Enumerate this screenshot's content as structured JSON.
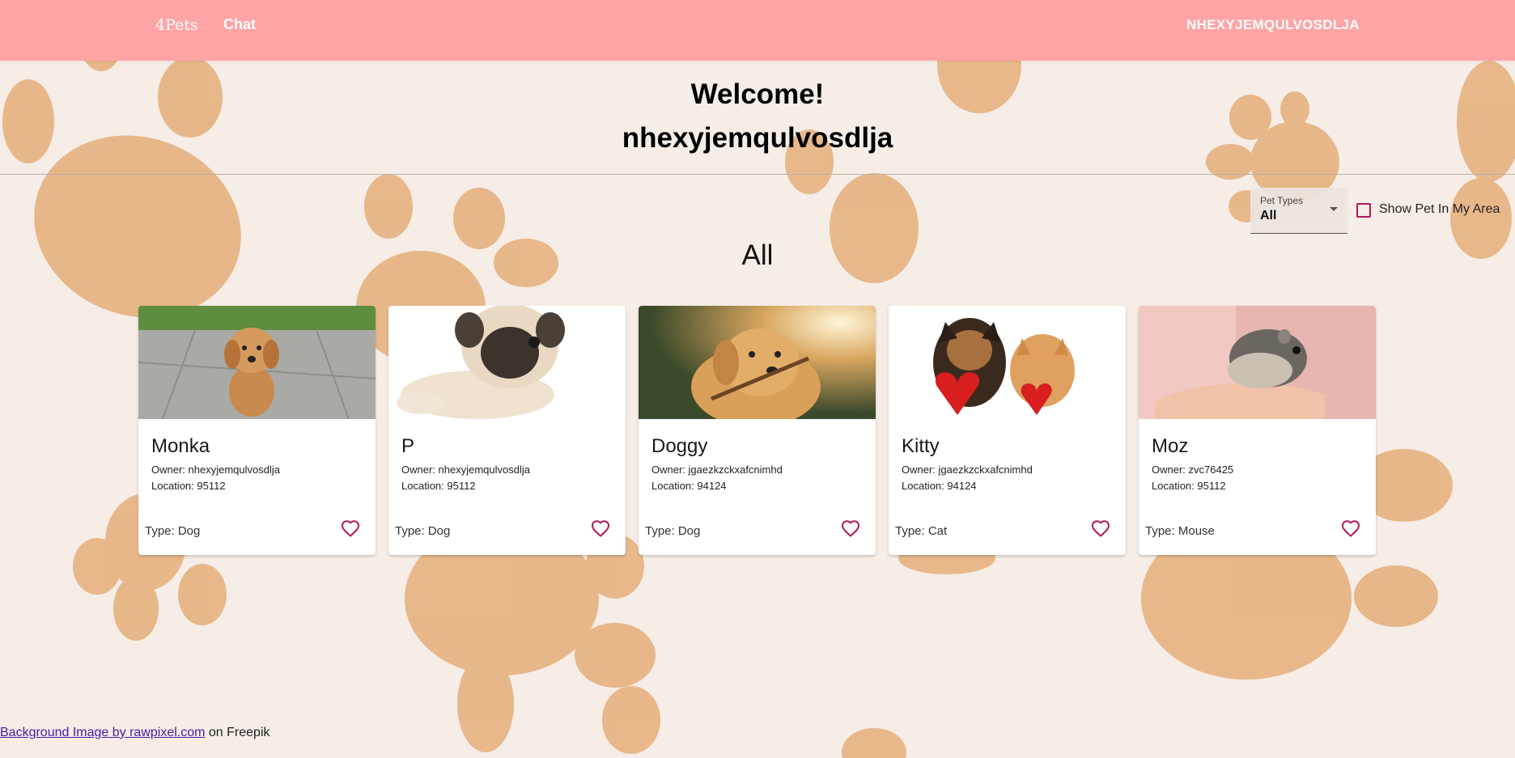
{
  "nav": {
    "brand": "4Pets",
    "chat": "Chat",
    "username": "NHEXYJEMQULVOSDLJA"
  },
  "welcome": {
    "greeting": "Welcome!",
    "name": "nhexyjemqulvosdlja"
  },
  "filters": {
    "pet_types_label": "Pet Types",
    "pet_types_value": "All",
    "show_in_area_label": "Show Pet In My Area",
    "show_in_area_checked": false
  },
  "section_title": "All",
  "pets": [
    {
      "name": "Monka",
      "owner": "Owner: nhexyjemqulvosdlja",
      "location": "Location: 95112",
      "type": "Type: Dog"
    },
    {
      "name": "P",
      "owner": "Owner: nhexyjemqulvosdlja",
      "location": "Location: 95112",
      "type": "Type: Dog"
    },
    {
      "name": "Doggy",
      "owner": "Owner: jgaezkzckxafcnimhd",
      "location": "Location: 94124",
      "type": "Type: Dog"
    },
    {
      "name": "Kitty",
      "owner": "Owner: jgaezkzckxafcnimhd",
      "location": "Location: 94124",
      "type": "Type: Cat"
    },
    {
      "name": "Moz",
      "owner": "Owner: zvc76425",
      "location": "Location: 95112",
      "type": "Type: Mouse"
    }
  ],
  "footer": {
    "link_text": "Background Image by rawpixel.com",
    "suffix": " on Freepik"
  },
  "colors": {
    "topbar": "#ffa4a4",
    "paw": "#e6b07e",
    "accent": "#b0185a"
  }
}
